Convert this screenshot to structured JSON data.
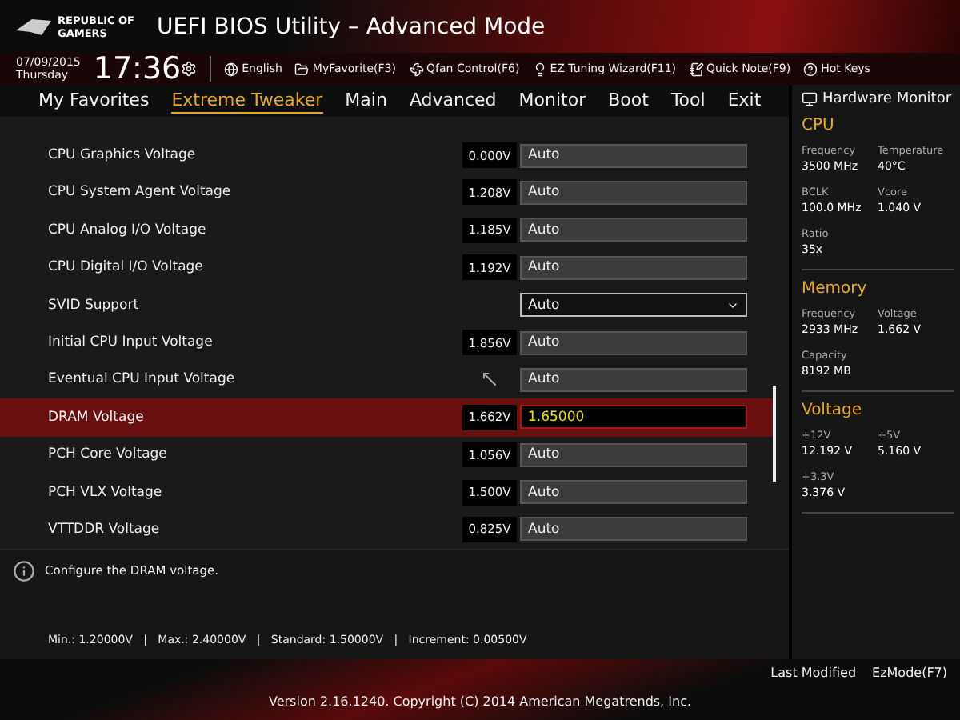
{
  "header": {
    "brand": [
      "REPUBLIC OF",
      "GAMERS"
    ],
    "title": "UEFI BIOS Utility – Advanced Mode"
  },
  "info_bar": {
    "date": "07/09/2015",
    "day": "Thursday",
    "time": "17:36",
    "items": [
      "English",
      "MyFavorite(F3)",
      "Qfan Control(F6)",
      "EZ Tuning Wizard(F11)",
      "Quick Note(F9)",
      "Hot Keys"
    ]
  },
  "tabs": [
    {
      "label": "My Favorites",
      "selected": false
    },
    {
      "label": "Extreme Tweaker",
      "selected": true
    },
    {
      "label": "Main",
      "selected": false
    },
    {
      "label": "Advanced",
      "selected": false
    },
    {
      "label": "Monitor",
      "selected": false
    },
    {
      "label": "Boot",
      "selected": false
    },
    {
      "label": "Tool",
      "selected": false
    },
    {
      "label": "Exit",
      "selected": false
    }
  ],
  "settings": [
    {
      "label": "CPU Graphics Voltage",
      "reading": "0.000V",
      "kind": "field",
      "value": "Auto",
      "selected": false
    },
    {
      "label": "CPU System Agent Voltage",
      "reading": "1.208V",
      "kind": "field",
      "value": "Auto",
      "selected": false
    },
    {
      "label": "CPU Analog I/O Voltage",
      "reading": "1.185V",
      "kind": "field",
      "value": "Auto",
      "selected": false
    },
    {
      "label": "CPU Digital I/O Voltage",
      "reading": "1.192V",
      "kind": "field",
      "value": "Auto",
      "selected": false
    },
    {
      "label": "SVID Support",
      "kind": "dropdown",
      "value": "Auto",
      "selected": false
    },
    {
      "label": "Initial CPU Input Voltage",
      "reading": "1.856V",
      "kind": "field",
      "value": "Auto",
      "selected": false
    },
    {
      "label": "Eventual CPU Input Voltage",
      "kind": "field",
      "value": "Auto",
      "selected": false
    },
    {
      "label": "DRAM Voltage",
      "reading": "1.662V",
      "kind": "field",
      "value": "1.65000",
      "selected": true
    },
    {
      "label": "PCH Core Voltage",
      "reading": "1.056V",
      "kind": "field",
      "value": "Auto",
      "selected": false
    },
    {
      "label": "PCH VLX Voltage",
      "reading": "1.500V",
      "kind": "field",
      "value": "Auto",
      "selected": false
    },
    {
      "label": "VTTDDR Voltage",
      "reading": "0.825V",
      "kind": "field",
      "value": "Auto",
      "selected": false
    }
  ],
  "help": {
    "text": "Configure the DRAM voltage.",
    "limits": "Min.: 1.20000V   |   Max.: 2.40000V   |   Standard: 1.50000V   |   Increment: 0.00500V"
  },
  "hardware_monitor": {
    "title": "Hardware Monitor",
    "sections": [
      {
        "title": "CPU",
        "stats": [
          {
            "label": "Frequency",
            "value": "3500 MHz"
          },
          {
            "label": "Temperature",
            "value": "40°C"
          },
          {
            "label": "BCLK",
            "value": "100.0 MHz"
          },
          {
            "label": "Vcore",
            "value": "1.040 V"
          },
          {
            "label": "Ratio",
            "value": "35x"
          }
        ]
      },
      {
        "title": "Memory",
        "stats": [
          {
            "label": "Frequency",
            "value": "2933 MHz"
          },
          {
            "label": "Voltage",
            "value": "1.662 V"
          },
          {
            "label": "Capacity",
            "value": "8192 MB"
          }
        ]
      },
      {
        "title": "Voltage",
        "stats": [
          {
            "label": "+12V",
            "value": "12.192 V"
          },
          {
            "label": "+5V",
            "value": "5.160 V"
          },
          {
            "label": "+3.3V",
            "value": "3.376 V"
          }
        ]
      }
    ]
  },
  "footer": {
    "version": "Version 2.16.1240. Copyright (C) 2014 American Megatrends, Inc.",
    "buttons": [
      "Last Modified",
      "EzMode(F7)"
    ]
  }
}
